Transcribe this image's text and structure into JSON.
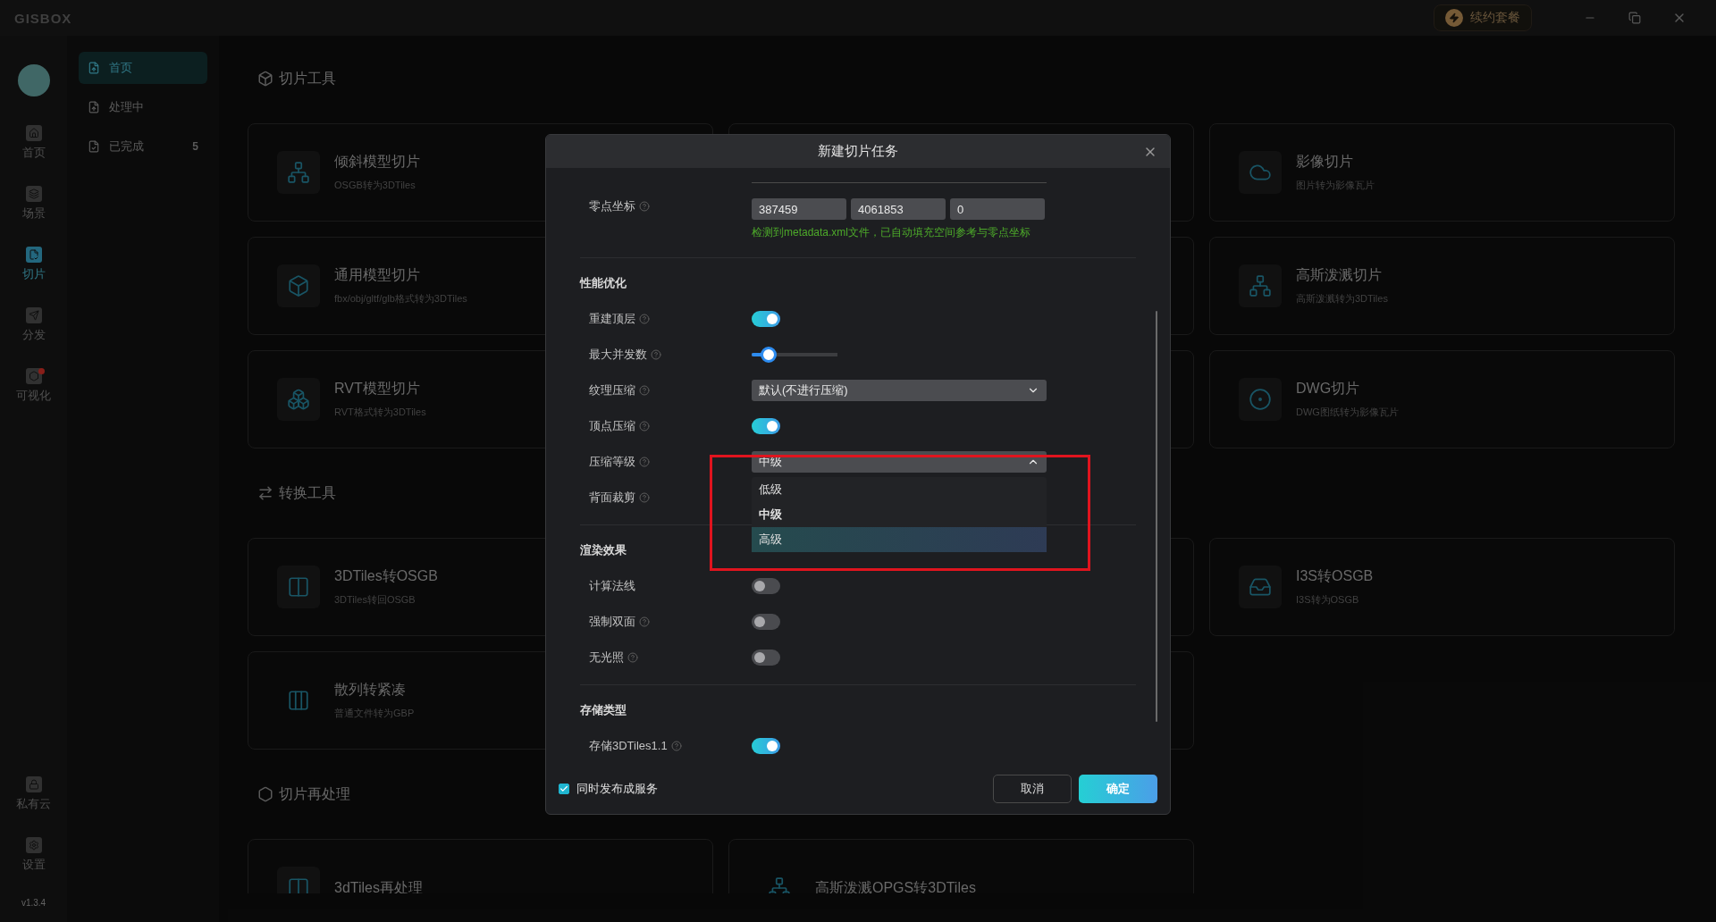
{
  "app": {
    "logo": "GISBOX",
    "renew_button": "续约套餐"
  },
  "rail": {
    "items": [
      {
        "label": "首页",
        "selected": false,
        "badge": false
      },
      {
        "label": "场景",
        "selected": false,
        "badge": false
      },
      {
        "label": "切片",
        "selected": true,
        "badge": false
      },
      {
        "label": "分发",
        "selected": false,
        "badge": false
      },
      {
        "label": "可视化",
        "selected": false,
        "badge": true
      }
    ],
    "bottom_items": [
      {
        "label": "私有云"
      },
      {
        "label": "设置"
      }
    ],
    "version": "v1.3.4"
  },
  "nav": {
    "items": [
      {
        "label": "首页",
        "selected": true
      },
      {
        "label": "处理中",
        "selected": false
      },
      {
        "label": "已完成",
        "selected": false,
        "count": "5"
      }
    ]
  },
  "sections": [
    {
      "title": "切片工具",
      "cards": [
        {
          "kind": "tool",
          "title": "倾斜模型切片",
          "subtitle": "OSGB转为3DTiles"
        },
        {
          "kind": "covered"
        },
        {
          "kind": "tool",
          "title": "影像切片",
          "subtitle": "图片转为影像瓦片"
        },
        {
          "kind": "tool",
          "title": "通用模型切片",
          "subtitle": "fbx/obj/gltf/glb格式转为3DTiles"
        },
        {
          "kind": "covered"
        },
        {
          "kind": "tool",
          "title": "高斯泼溅切片",
          "subtitle": "高斯泼溅转为3DTiles"
        },
        {
          "kind": "tool",
          "title": "RVT模型切片",
          "subtitle": "RVT格式转为3DTiles"
        },
        {
          "kind": "covered"
        },
        {
          "kind": "tool",
          "title": "DWG切片",
          "subtitle": "DWG图纸转为影像瓦片"
        }
      ]
    },
    {
      "title": "转换工具",
      "cards": [
        {
          "kind": "tool",
          "title": "3DTiles转OSGB",
          "subtitle": "3DTiles转回OSGB"
        },
        {
          "kind": "covered"
        },
        {
          "kind": "tool",
          "title": "I3S转OSGB",
          "subtitle": "I3S转为OSGB"
        },
        {
          "kind": "tool",
          "title": "散列转紧凑",
          "subtitle": "普通文件转为GBP"
        },
        {
          "kind": "covered"
        }
      ]
    },
    {
      "title": "切片再处理",
      "cards": [
        {
          "kind": "tool",
          "title": "3dTiles再处理"
        },
        {
          "kind": "tool",
          "title": "高斯泼溅OPGS转3DTiles"
        }
      ]
    }
  ],
  "dialog": {
    "title": "新建切片任务",
    "coordinate": {
      "label": "零点坐标",
      "help": true,
      "values": [
        "387459",
        "4061853",
        "0"
      ],
      "hint": "检测到metadata.xml文件，已自动填充空间参考与零点坐标"
    },
    "groups": [
      {
        "title": "性能优化",
        "rows": [
          {
            "kind": "toggle",
            "label": "重建顶层",
            "help": true,
            "on": true
          },
          {
            "kind": "slider",
            "label": "最大并发数",
            "help": true,
            "level": 0.2
          },
          {
            "kind": "select",
            "label": "纹理压缩",
            "help": true,
            "value": "默认(不进行压缩)",
            "expanded": false
          },
          {
            "kind": "toggle",
            "label": "顶点压缩",
            "help": true,
            "on": true
          },
          {
            "kind": "select",
            "label": "压缩等级",
            "help": true,
            "value": "中级",
            "expanded": true,
            "options": [
              {
                "label": "低级",
                "selected": false,
                "hovered": false
              },
              {
                "label": "中级",
                "selected": true,
                "hovered": false
              },
              {
                "label": "高级",
                "selected": false,
                "hovered": true
              }
            ]
          },
          {
            "kind": "covered",
            "label": "背面裁剪",
            "help": true
          }
        ]
      },
      {
        "title": "渲染效果",
        "rows": [
          {
            "kind": "toggle",
            "label": "计算法线",
            "help": false,
            "on": false
          },
          {
            "kind": "toggle",
            "label": "强制双面",
            "help": true,
            "on": false
          },
          {
            "kind": "toggle",
            "label": "无光照",
            "help": true,
            "on": false
          }
        ]
      },
      {
        "title": "存储类型",
        "rows": [
          {
            "kind": "toggle",
            "label": "存储3DTiles1.1",
            "help": true,
            "on": true
          }
        ]
      }
    ],
    "publish": {
      "label": "同时发布成服务",
      "checked": true
    },
    "buttons": [
      {
        "label": "取消",
        "kind": "secondary"
      },
      {
        "label": "确定",
        "kind": "primary"
      }
    ]
  }
}
